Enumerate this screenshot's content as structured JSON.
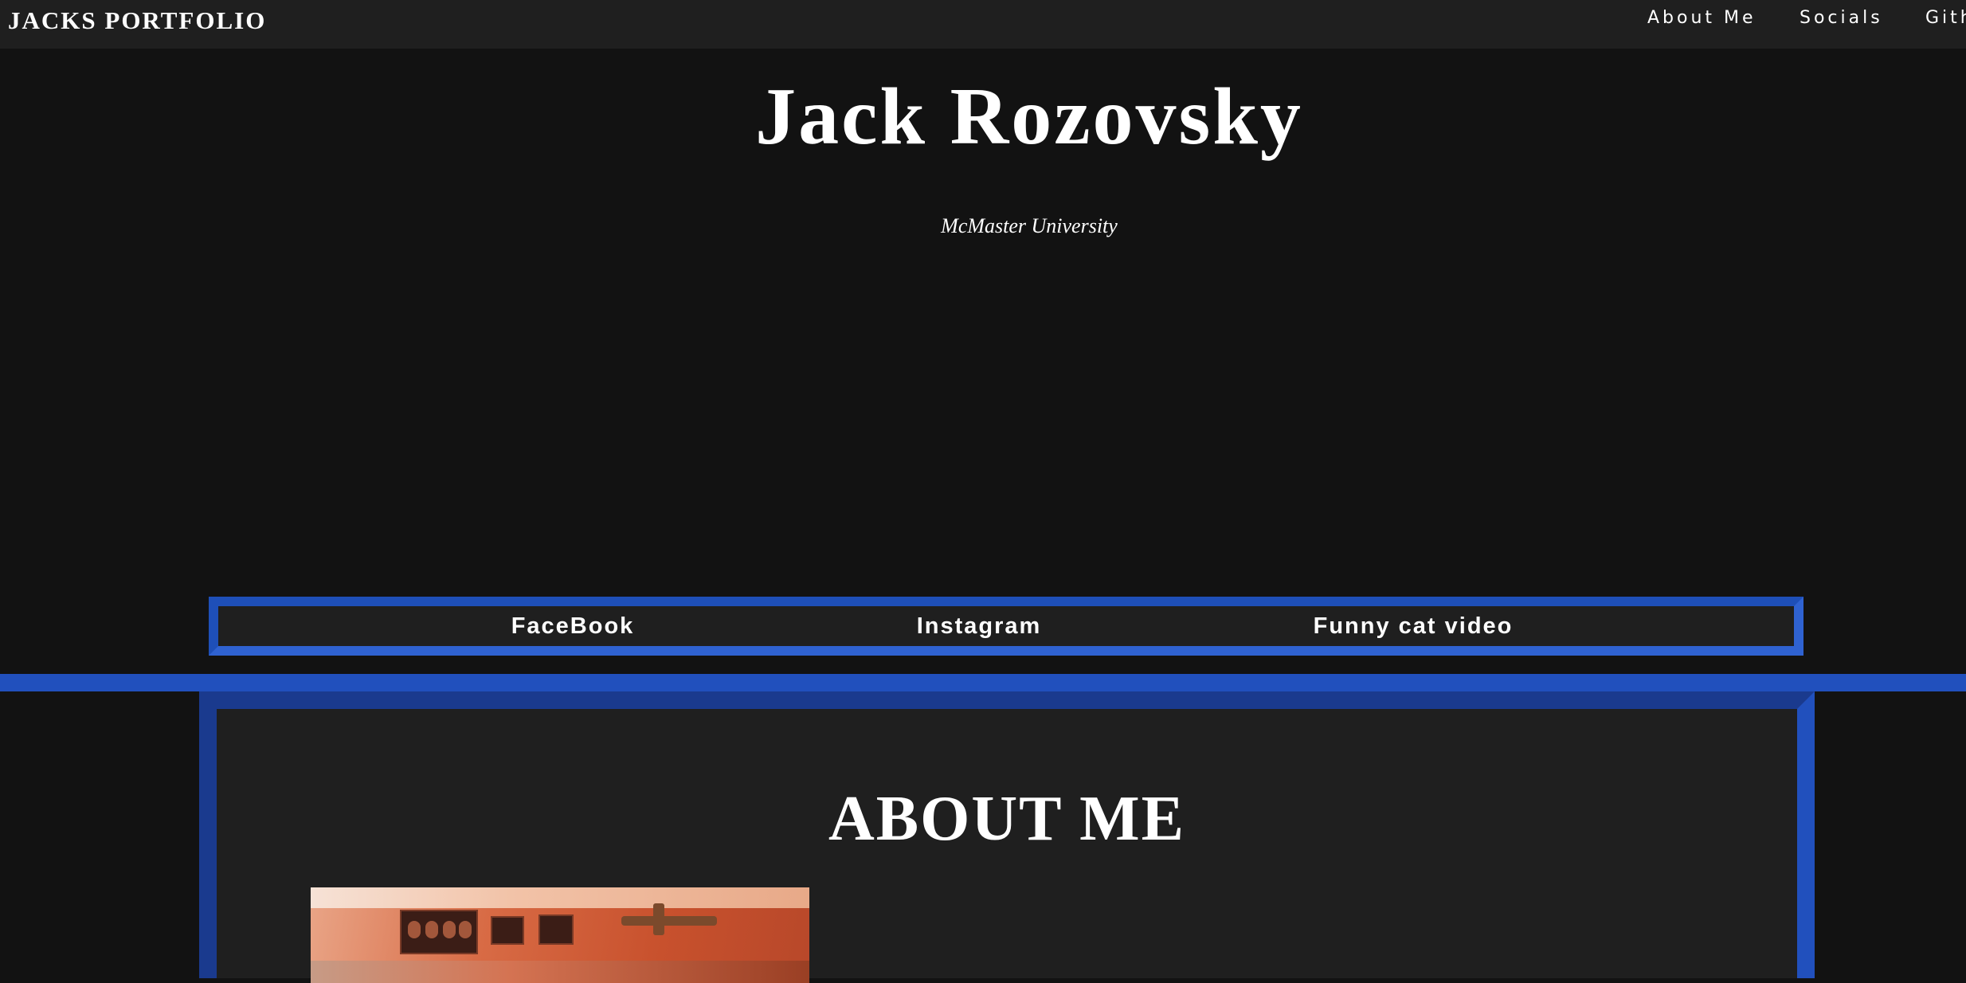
{
  "header": {
    "brand": "JACKS PORTFOLIO",
    "nav": [
      {
        "label": "About Me"
      },
      {
        "label": "Socials"
      },
      {
        "label": "Github"
      }
    ]
  },
  "hero": {
    "name": "Jack Rozovsky",
    "school": "McMaster University"
  },
  "socials": {
    "links": [
      {
        "label": "FaceBook"
      },
      {
        "label": "Instagram"
      },
      {
        "label": "Funny cat video"
      }
    ]
  },
  "about": {
    "heading": "ABOUT ME"
  },
  "colors": {
    "background": "#121212",
    "panel": "#1f1f1f",
    "accent_blue": "#2150bd",
    "text": "#ffffff"
  }
}
